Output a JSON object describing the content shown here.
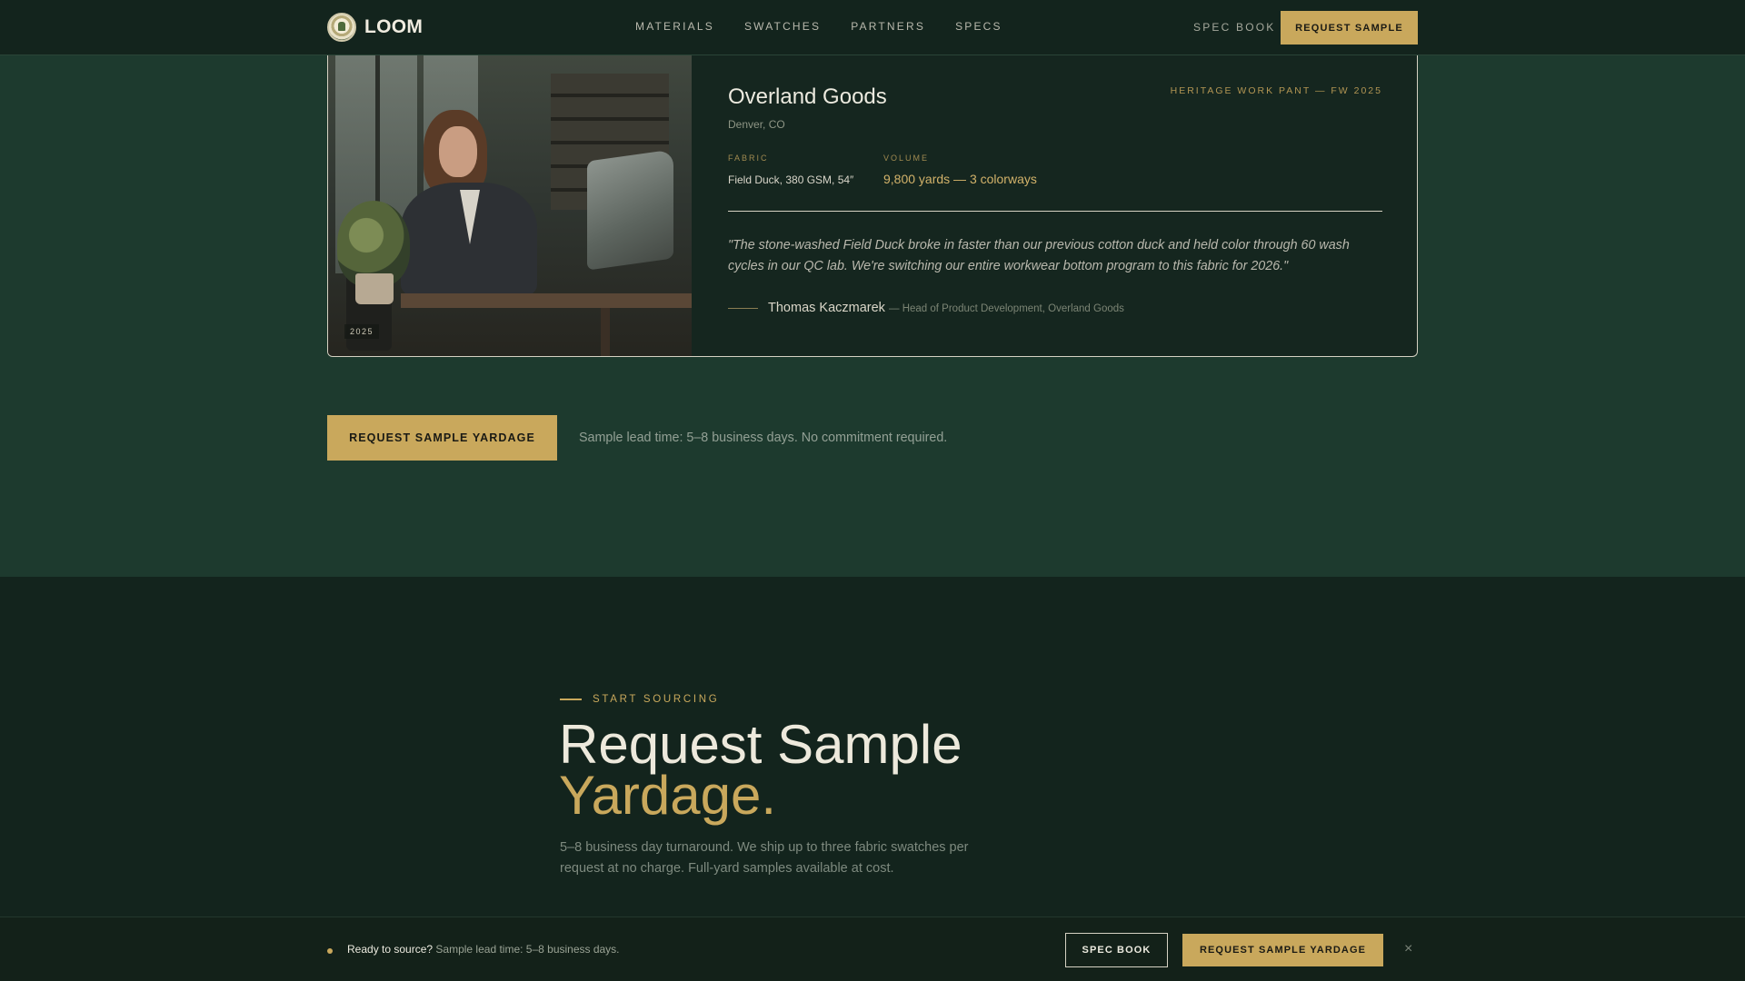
{
  "nav": {
    "brand": "LOOM",
    "links": [
      "MATERIALS",
      "SWATCHES",
      "PARTNERS",
      "SPECS"
    ],
    "spec_book": "SPEC BOOK",
    "cta": "REQUEST SAMPLE"
  },
  "case_study": {
    "photo_tag": "2025",
    "company": "Overland Goods",
    "city": "Denver, CO",
    "program": "HERITAGE WORK PANT — FW 2025",
    "fabric_label": "FABRIC",
    "fabric_value": "Field Duck, 380 GSM, 54″",
    "volume_label": "VOLUME",
    "volume_value": "9,800 yards — 3 colorways",
    "quote": "\"The stone-washed Field Duck broke in faster than our previous cotton duck and held color through 60 wash cycles in our QC lab. We're switching our entire workwear bottom program to this fabric for 2026.\"",
    "author": "Thomas Kaczmarek",
    "author_role": "— Head of Product Development, Overland Goods"
  },
  "cta_row": {
    "button": "REQUEST SAMPLE YARDAGE",
    "note": "Sample lead time: 5–8 business days. No commitment required."
  },
  "sourcing": {
    "eyebrow": "START SOURCING",
    "headline_line1": "Request Sample",
    "headline_line2": "Yardage.",
    "lede": "5–8 business day turnaround. We ship up to three fabric swatches per request at no charge. Full-yard samples available at cost."
  },
  "sticky_bar": {
    "lead": "Ready to source?",
    "text": "Sample lead time: 5–8 business days.",
    "spec_book": "SPEC BOOK",
    "cta": "REQUEST SAMPLE YARDAGE",
    "close": "×"
  },
  "colors": {
    "accent": "#c9a85c",
    "background": "#1d3a2e",
    "dark": "#13241d"
  }
}
